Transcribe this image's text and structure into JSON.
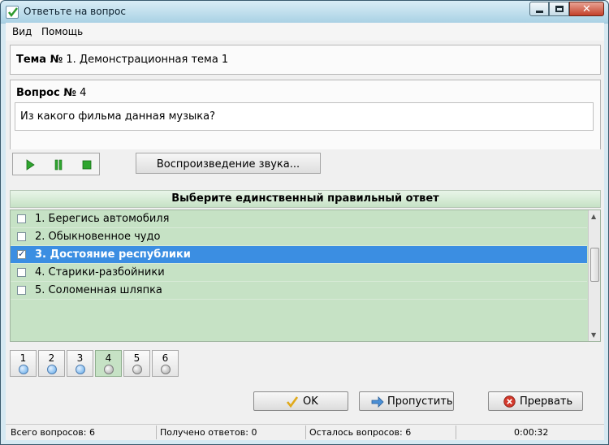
{
  "window": {
    "title": "Ответьте на вопрос",
    "accent_color": "#3b8ee2",
    "answer_bg_color": "#c6e2c5"
  },
  "menu": {
    "items": [
      "Вид",
      "Помощь"
    ]
  },
  "theme": {
    "prefix": "Тема №",
    "value": "1. Демонстрационная тема 1"
  },
  "question": {
    "prefix": "Вопрос №",
    "number": "4",
    "text": "Из какого фильма данная музыка?"
  },
  "player": {
    "play_icon": "play-icon",
    "pause_icon": "pause-icon",
    "stop_icon": "stop-icon",
    "sound_button_label": "Воспроизведение звука..."
  },
  "answers": {
    "header": "Выберите единственный правильный ответ",
    "items": [
      {
        "label": "1. Берегись автомобиля",
        "checked": false
      },
      {
        "label": "2. Обыкновенное чудо",
        "checked": false
      },
      {
        "label": "3. Достояние республики",
        "checked": true
      },
      {
        "label": "4. Старики-разбойники",
        "checked": false
      },
      {
        "label": "5. Соломенная шляпка",
        "checked": false
      }
    ]
  },
  "question_nav": [
    {
      "label": "1",
      "status": "answered"
    },
    {
      "label": "2",
      "status": "answered"
    },
    {
      "label": "3",
      "status": "answered"
    },
    {
      "label": "4",
      "status": "current"
    },
    {
      "label": "5",
      "status": "unanswered"
    },
    {
      "label": "6",
      "status": "unanswered"
    }
  ],
  "buttons": {
    "ok": "OK",
    "skip": "Пропустить",
    "stop": "Прервать"
  },
  "status": {
    "total": "Всего вопросов: 6",
    "answered": "Получено ответов: 0",
    "remaining": "Осталось вопросов: 6",
    "time": "0:00:32"
  }
}
